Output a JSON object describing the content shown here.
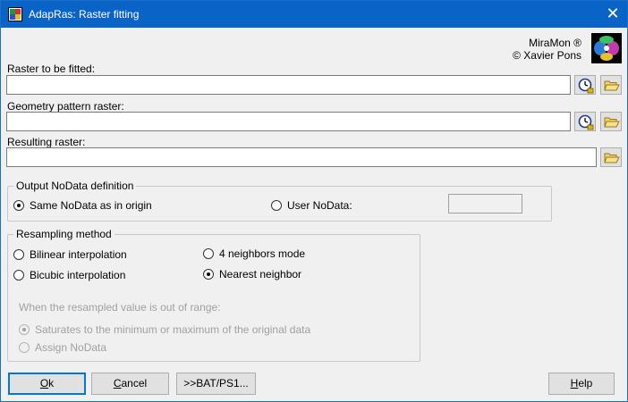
{
  "window": {
    "title": "AdapRas: Raster fitting",
    "close_glyph": "✕"
  },
  "brand": {
    "line1": "MiraMon ®",
    "line2": "© Xavier Pons"
  },
  "inputs": {
    "raster_to_fit": {
      "label": "Raster to be fitted:",
      "value": ""
    },
    "geometry_pattern": {
      "label": "Geometry pattern raster:",
      "value": ""
    },
    "resulting": {
      "label": "Resulting raster:",
      "value": ""
    }
  },
  "icons": {
    "metadata": "metadata-clock-icon",
    "browse": "folder-open-icon"
  },
  "nodata": {
    "legend": "Output NoData definition",
    "same_label": "Same NoData as in origin",
    "same_selected": true,
    "user_label": "User NoData:",
    "user_selected": false,
    "user_value": ""
  },
  "resampling": {
    "legend": "Resampling method",
    "bilinear": "Bilinear interpolation",
    "bicubic": "Bicubic interpolation",
    "four_neighbors": "4 neighbors mode",
    "nearest": "Nearest neighbor",
    "selected": "nearest",
    "out_of_range_label": "When the resampled value is out of range:",
    "saturate": "Saturates to the minimum or maximum of the original data",
    "saturate_selected": true,
    "assign_nodata": "Assign NoData"
  },
  "buttons": {
    "ok_prefix": "",
    "ok_underlined": "O",
    "ok_suffix": "k",
    "cancel_prefix": "",
    "cancel_underlined": "C",
    "cancel_suffix": "ancel",
    "bat": ">>BAT/PS1...",
    "help_prefix": "",
    "help_underlined": "H",
    "help_suffix": "elp"
  },
  "colors": {
    "titlebar": "#0a64c8",
    "dialog_bg": "#f0f0f0",
    "default_button_border": "#0078d7"
  }
}
